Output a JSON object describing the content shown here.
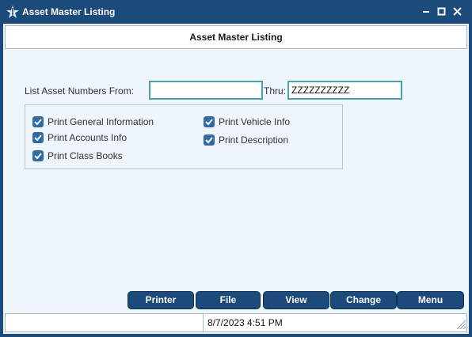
{
  "window": {
    "title": "Asset Master Listing",
    "accent_color": "#1c4a7a",
    "controls": [
      "minimize-icon",
      "maximize-icon",
      "close-icon"
    ]
  },
  "header": {
    "title": "Asset Master Listing"
  },
  "form": {
    "from_label": "List Asset Numbers From:",
    "from_value": "",
    "thru_label": "Thru:",
    "thru_value": "ZZZZZZZZZZ"
  },
  "options": [
    {
      "label": "Print General Information",
      "checked": true
    },
    {
      "label": "Print Accounts Info",
      "checked": true
    },
    {
      "label": "Print Class Books",
      "checked": true
    },
    {
      "label": "Print Vehicle Info",
      "checked": true
    },
    {
      "label": "Print Description",
      "checked": true
    }
  ],
  "buttons": {
    "printer": "Printer",
    "file": "File",
    "view": "View",
    "change": "Change",
    "menu": "Menu"
  },
  "status": {
    "datetime": "8/7/2023 4:51 PM"
  }
}
